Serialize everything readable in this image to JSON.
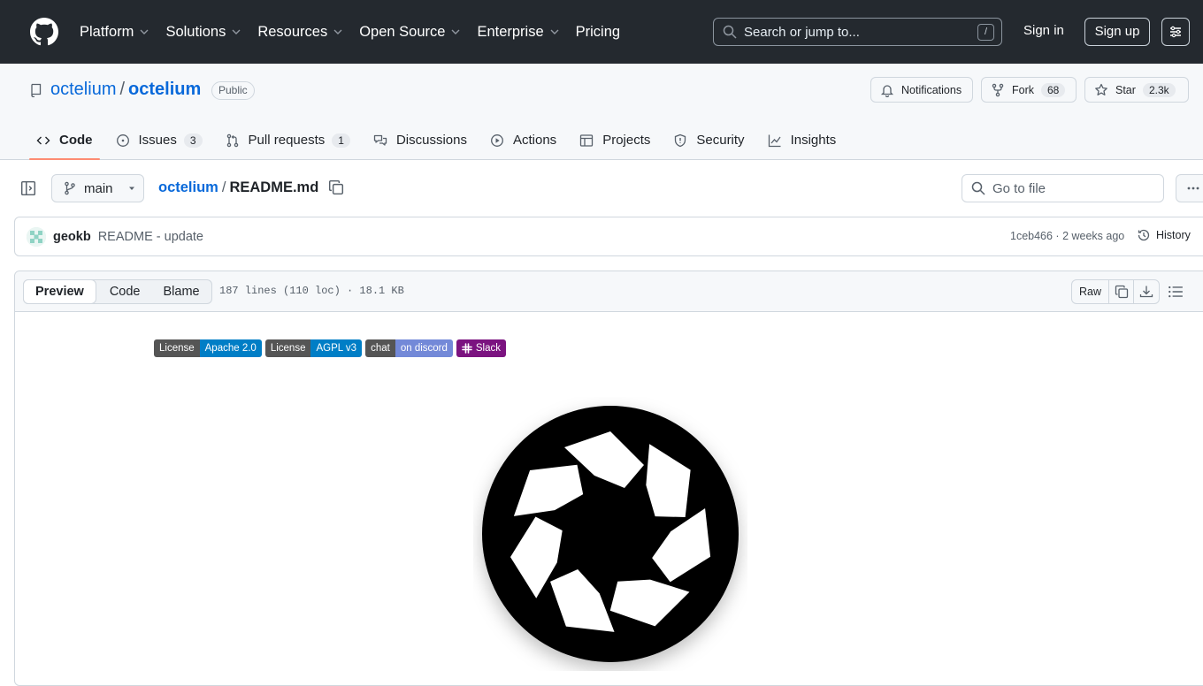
{
  "topnav": {
    "items": [
      "Platform",
      "Solutions",
      "Resources",
      "Open Source",
      "Enterprise",
      "Pricing"
    ],
    "search_placeholder": "Search or jump to...",
    "search_shortcut": "/",
    "signin": "Sign in",
    "signup": "Sign up"
  },
  "repo": {
    "owner": "octelium",
    "name": "octelium",
    "visibility": "Public",
    "notifications": "Notifications",
    "fork_label": "Fork",
    "fork_count": "68",
    "star_label": "Star",
    "star_count": "2.3k"
  },
  "tabs": [
    {
      "label": "Code"
    },
    {
      "label": "Issues",
      "count": "3"
    },
    {
      "label": "Pull requests",
      "count": "1"
    },
    {
      "label": "Discussions"
    },
    {
      "label": "Actions"
    },
    {
      "label": "Projects"
    },
    {
      "label": "Security"
    },
    {
      "label": "Insights"
    }
  ],
  "filebar": {
    "branch": "main",
    "crumb_repo": "octelium",
    "crumb_sep": "/",
    "file": "README.md",
    "goto_placeholder": "Go to file"
  },
  "commit": {
    "author": "geokb",
    "message": "README - update",
    "meta": "1ceb466 · 2 weeks ago",
    "history": "History"
  },
  "fileview": {
    "modes": [
      "Preview",
      "Code",
      "Blame"
    ],
    "info": "187 lines (110 loc) · 18.1 KB",
    "raw": "Raw"
  },
  "readme": {
    "badges": [
      {
        "left": "License",
        "right": "Apache 2.0",
        "color": "#007ec6"
      },
      {
        "left": "License",
        "right": "AGPL v3",
        "color": "#007ec6"
      },
      {
        "left": "chat",
        "right": "on discord",
        "color": "#7389d8"
      }
    ],
    "slack_badge": "Slack",
    "slack_color": "#7b1380"
  },
  "colors": {
    "header_bg": "#24292f",
    "link": "#0969da",
    "active_tab_underline": "#fd8c73"
  }
}
